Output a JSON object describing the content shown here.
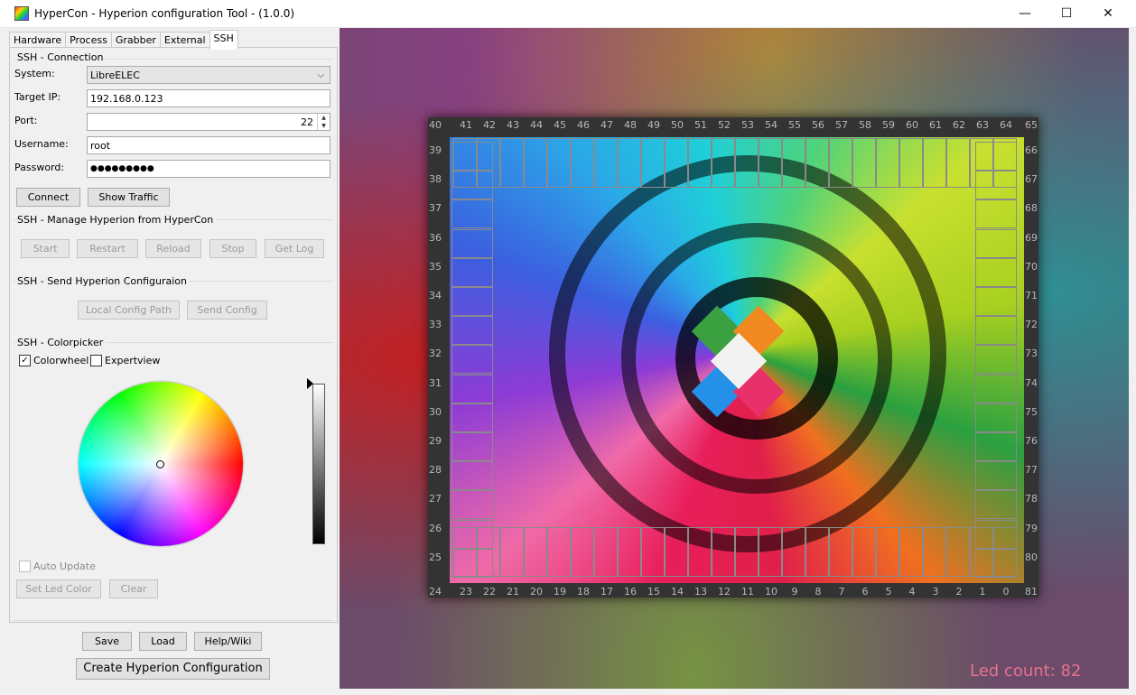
{
  "window": {
    "title": "HyperCon - Hyperion configuration Tool - (1.0.0)",
    "minimize": "—",
    "maximize": "☐",
    "close": "✕"
  },
  "tabs": [
    "Hardware",
    "Process",
    "Grabber",
    "External",
    "SSH"
  ],
  "active_tab": "SSH",
  "connection": {
    "title": "SSH - Connection",
    "system_label": "System:",
    "system_value": "LibreELEC",
    "ip_label": "Target IP:",
    "ip_value": "192.168.0.123",
    "port_label": "Port:",
    "port_value": "22",
    "user_label": "Username:",
    "user_value": "root",
    "pass_label": "Password:",
    "pass_value": "●●●●●●●●●",
    "connect": "Connect",
    "show_traffic": "Show Traffic"
  },
  "manage": {
    "title": "SSH - Manage Hyperion from HyperCon",
    "start": "Start",
    "restart": "Restart",
    "reload": "Reload",
    "stop": "Stop",
    "getlog": "Get Log"
  },
  "send": {
    "title": "SSH - Send Hyperion Configuraion",
    "local_path": "Local Config Path",
    "send_config": "Send Config"
  },
  "colorpicker": {
    "title": "SSH - Colorpicker",
    "colorwheel": "Colorwheel",
    "colorwheel_checked": "✓",
    "expertview": "Expertview",
    "auto_update": "Auto Update",
    "set_led": "Set Led Color",
    "clear": "Clear"
  },
  "footer": {
    "save": "Save",
    "load": "Load",
    "help": "Help/Wiki",
    "create": "Create Hyperion Configuration"
  },
  "preview": {
    "led_count": "Led count: 82",
    "top_numbers": [
      "40",
      "41",
      "42",
      "43",
      "44",
      "45",
      "46",
      "47",
      "48",
      "49",
      "50",
      "51",
      "52",
      "53",
      "54",
      "55",
      "56",
      "57",
      "58",
      "59",
      "60",
      "61",
      "62",
      "63",
      "64",
      "65"
    ],
    "bottom_numbers": [
      "24",
      "23",
      "22",
      "21",
      "20",
      "19",
      "18",
      "17",
      "16",
      "15",
      "14",
      "13",
      "12",
      "11",
      "10",
      "9",
      "8",
      "7",
      "6",
      "5",
      "4",
      "3",
      "2",
      "1",
      "0",
      "81"
    ],
    "left_numbers": [
      "39",
      "38",
      "37",
      "36",
      "35",
      "34",
      "33",
      "32",
      "31",
      "30",
      "29",
      "28",
      "27",
      "26",
      "25"
    ],
    "right_numbers": [
      "66",
      "67",
      "68",
      "69",
      "70",
      "71",
      "72",
      "73",
      "74",
      "75",
      "76",
      "77",
      "78",
      "79",
      "80"
    ]
  }
}
